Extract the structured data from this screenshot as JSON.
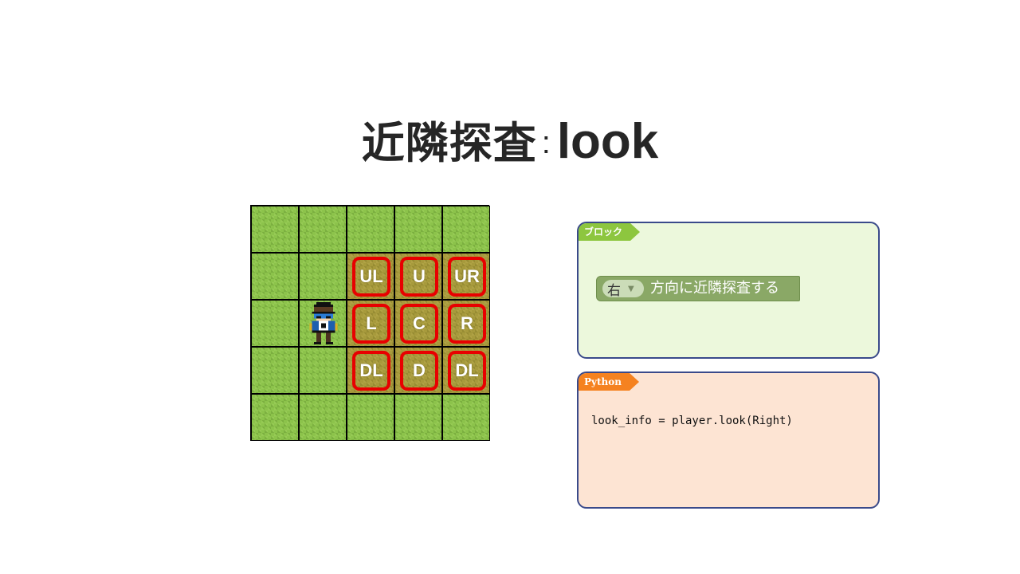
{
  "title": {
    "jp": "近隣探査",
    "colon": ":",
    "en": "look"
  },
  "grid": {
    "labels": [
      "UL",
      "U",
      "UR",
      "L",
      "C",
      "R",
      "DL",
      "D",
      "DL"
    ],
    "highlight_color": "#e80000"
  },
  "block_panel": {
    "tag": "ブロック",
    "dropdown_value": "右",
    "text": "方向に近隣探査する"
  },
  "python_panel": {
    "tag": "Python",
    "code": "look_info = player.look(Right)"
  },
  "colors": {
    "grass": "#8cc34b",
    "selected_tile": "#a79a3c",
    "block_tag": "#8dc63f",
    "python_tag": "#f58220",
    "panel_border": "#3a4a8a"
  }
}
